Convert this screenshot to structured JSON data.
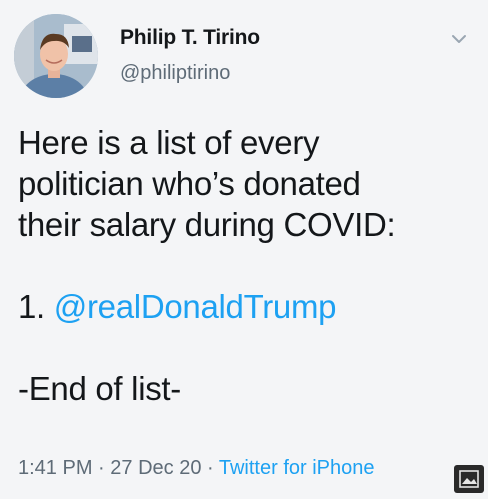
{
  "author": {
    "display_name": "Philip T. Tirino",
    "handle": "@philiptirino",
    "avatar_icon": "profile-photo"
  },
  "tweet": {
    "line1": "Here is a list of every",
    "line2": "politician who’s donated",
    "line3": "their salary during COVID:",
    "list_number": "1. ",
    "mention": "@realDonaldTrump",
    "end_text": "-End of list-"
  },
  "meta": {
    "time": "1:41 PM",
    "separator": " · ",
    "date": "27 Dec 20",
    "source": "Twitter for iPhone"
  },
  "colors": {
    "link": "#1da1f2",
    "secondary_text": "#5e6b77",
    "primary_text": "#14171a"
  },
  "icons": {
    "menu": "chevron-down-icon",
    "overlay": "image-badge-icon"
  }
}
